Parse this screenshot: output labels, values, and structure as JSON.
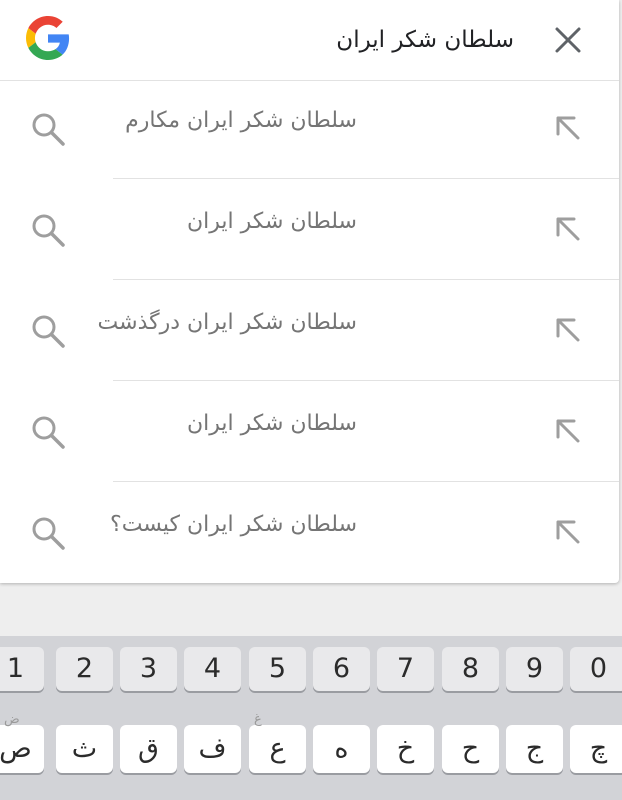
{
  "search": {
    "query": "سلطان شکر ایران",
    "suggestions": [
      {
        "text": "سلطان شکر ایران مکارم"
      },
      {
        "text": "سلطان شکر ایران"
      },
      {
        "text": "سلطان شکر ایران درگذشت"
      },
      {
        "text": "سلطان شکر ایران"
      },
      {
        "text": "سلطان شکر ایران کیست؟"
      }
    ]
  },
  "icons": {
    "logo": "google-logo",
    "clear": "close-icon",
    "suggestion": "search-icon",
    "fill": "arrow-up-left-icon"
  },
  "colors": {
    "google_blue": "#4285F4",
    "google_red": "#EA4335",
    "google_yellow": "#FBBC05",
    "google_green": "#34A853",
    "suggestion_text": "#757575",
    "keyboard_bg": "#d2d3d7"
  },
  "keyboard": {
    "number_row": [
      "1",
      "2",
      "3",
      "4",
      "5",
      "6",
      "7",
      "8",
      "9",
      "0"
    ],
    "letter_row": [
      {
        "label": "ص",
        "alt": "ض"
      },
      {
        "label": "ث",
        "alt": ""
      },
      {
        "label": "ق",
        "alt": ""
      },
      {
        "label": "ف",
        "alt": ""
      },
      {
        "label": "ع",
        "alt": "غ"
      },
      {
        "label": "ه",
        "alt": ""
      },
      {
        "label": "خ",
        "alt": ""
      },
      {
        "label": "ح",
        "alt": ""
      },
      {
        "label": "ج",
        "alt": ""
      },
      {
        "label": "چ",
        "alt": ""
      }
    ]
  }
}
